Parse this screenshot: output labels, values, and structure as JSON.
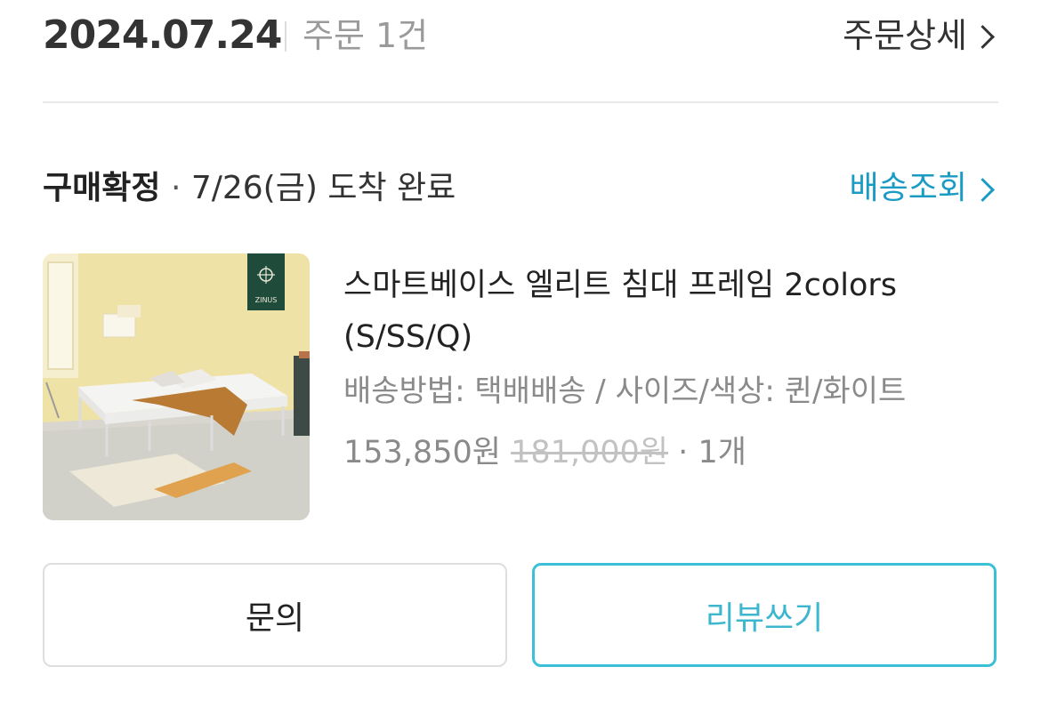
{
  "order": {
    "date": "2024.07.24",
    "count_label": "주문 1건",
    "detail_link": "주문상세"
  },
  "status": {
    "label": "구매확정",
    "separator": "·",
    "arrival": "7/26(금) 도착 완료",
    "tracking_link": "배송조회"
  },
  "product": {
    "name": "스마트베이스 엘리트 침대 프레임 2colors (S/SS/Q)",
    "options": "배송방법: 택배배송 / 사이즈/색상: 퀸/화이트",
    "price": "153,850원",
    "original_price": "181,000원",
    "quantity": "1개",
    "image_brand": "ZINUS"
  },
  "buttons": {
    "inquiry": "문의",
    "review": "리뷰쓰기"
  },
  "colors": {
    "accent": "#1a9bc4",
    "review_border": "#3cc0d8",
    "muted": "#8a8a8a"
  }
}
